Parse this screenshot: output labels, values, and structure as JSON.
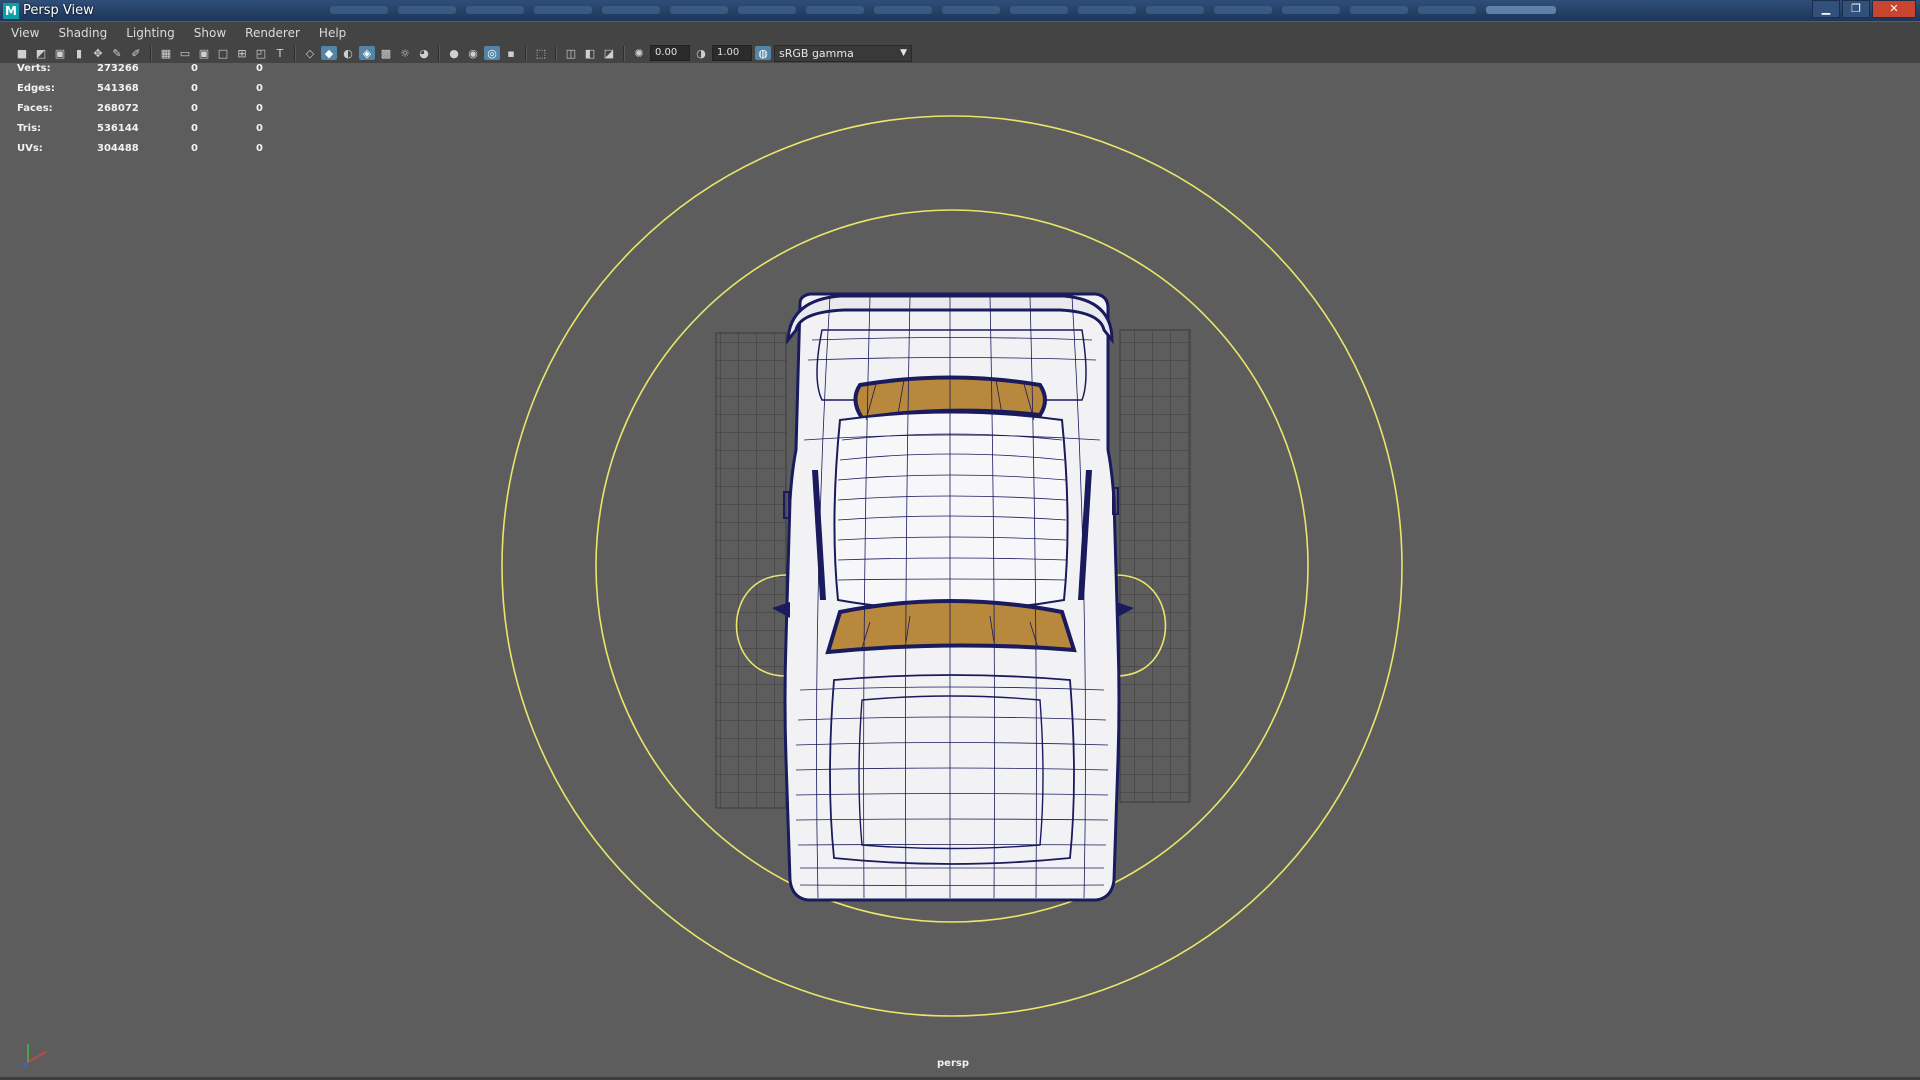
{
  "window": {
    "title": "Persp View",
    "app_icon_letter": "M",
    "controls": {
      "minimize": "▁",
      "maximize": "❐",
      "close": "✕"
    }
  },
  "menu": {
    "items": [
      {
        "label": "View"
      },
      {
        "label": "Shading"
      },
      {
        "label": "Lighting"
      },
      {
        "label": "Show"
      },
      {
        "label": "Renderer"
      },
      {
        "label": "Help"
      }
    ]
  },
  "toolbar": {
    "exposure": "0.00",
    "gamma": "1.00",
    "color_space": "sRGB gamma",
    "icons": [
      "camera-icon",
      "camera-attributes-icon",
      "bookmark-icon",
      "image-plane-icon",
      "2d-pan-zoom-icon",
      "grease-pencil-icon",
      "sep",
      "grid-icon",
      "film-gate-icon",
      "resolution-gate-icon",
      "gate-mask-icon",
      "field-chart-icon",
      "safe-action-icon",
      "safe-title-icon",
      "sep",
      "wireframe-icon",
      "smooth-shade-icon",
      "default-material-icon",
      "wireframe-on-shaded-icon",
      "textured-icon",
      "use-all-lights-icon",
      "shadows-icon",
      "sep",
      "screen-space-ao-icon",
      "motion-blur-icon",
      "multisample-aa-icon",
      "depth-of-field-icon",
      "sep",
      "isolate-select-icon",
      "sep",
      "xray-icon",
      "xray-joints-icon",
      "xray-active-icon",
      "sep",
      "exposure-icon"
    ]
  },
  "stats": {
    "rows": [
      {
        "label": "Verts:",
        "value": "273266",
        "c1": "0",
        "c2": "0"
      },
      {
        "label": "Edges:",
        "value": "541368",
        "c1": "0",
        "c2": "0"
      },
      {
        "label": "Faces:",
        "value": "268072",
        "c1": "0",
        "c2": "0"
      },
      {
        "label": "Tris:",
        "value": "536144",
        "c1": "0",
        "c2": "0"
      },
      {
        "label": "UVs:",
        "value": "304488",
        "c1": "0",
        "c2": "0"
      }
    ]
  },
  "viewport": {
    "camera": "persp",
    "background": "#5d5d5d",
    "wire_color": "#1a1a5e",
    "glass_color": "#b8883c",
    "light_ring_color": "#e9e66a"
  }
}
